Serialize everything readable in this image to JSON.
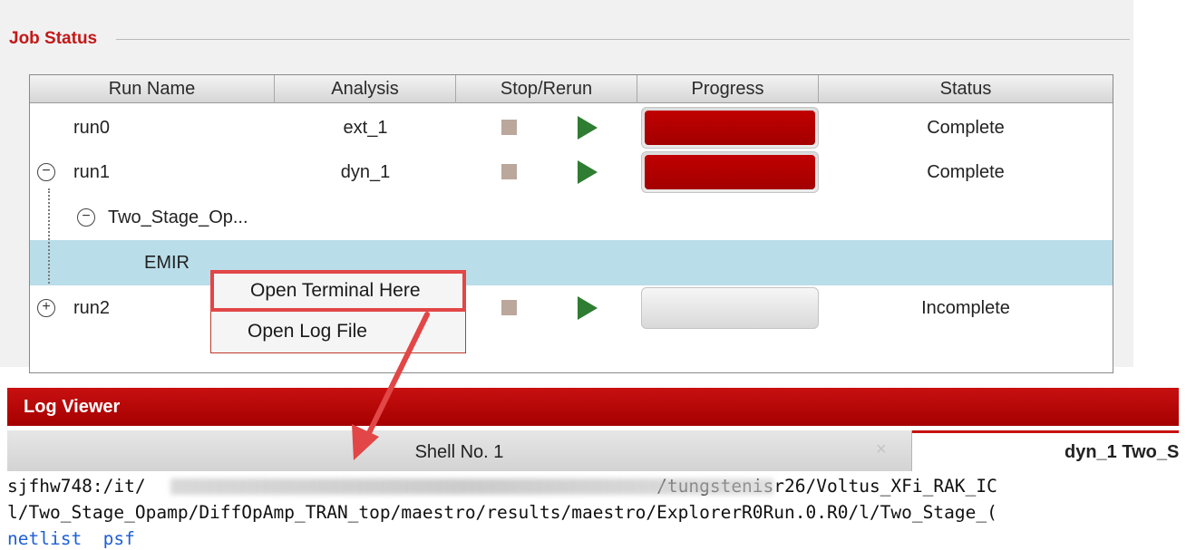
{
  "job_status": {
    "title": "Job Status",
    "columns": [
      "Run Name",
      "Analysis",
      "Stop/Rerun",
      "Progress",
      "Status"
    ],
    "rows": [
      {
        "name": "run0",
        "analysis": "ext_1",
        "progress": 1.0,
        "status": "Complete"
      },
      {
        "name": "run1",
        "analysis": "dyn_1",
        "progress": 1.0,
        "status": "Complete",
        "expander": "−"
      },
      {
        "name": "Two_Stage_Op...",
        "expander": "−"
      },
      {
        "name": "EMIR",
        "selected": true
      },
      {
        "name": "run2",
        "progress": 0.0,
        "status": "Incomplete",
        "expander": "+"
      }
    ]
  },
  "context_menu": {
    "items": [
      "Open Terminal Here",
      "Open Log File"
    ]
  },
  "log_viewer": {
    "title": "Log Viewer",
    "tabs": [
      "Shell No. 1",
      "dyn_1 Two_S"
    ],
    "tab_close": "×",
    "terminal_lines": [
      "sjfhw748:/it/                                                /tungstenisr26/Voltus_XFi_RAK_IC",
      "l/Two_Stage_Opamp/DiffOpAmp_TRAN_top/maestro/results/maestro/ExplorerR0Run.0.R0/l/Two_Stage_(",
      "netlist  psf"
    ]
  },
  "colors": {
    "title_red": "#c41818",
    "progress_fill": "#b00000",
    "selected_row": "#b9dde9",
    "play_green": "#2e7d32",
    "highlight": "#e24646"
  },
  "icons": {
    "stop": "stop-square-icon",
    "rerun": "play-triangle-icon",
    "collapse": "collapse-circle-icon",
    "expand": "expand-circle-icon"
  }
}
